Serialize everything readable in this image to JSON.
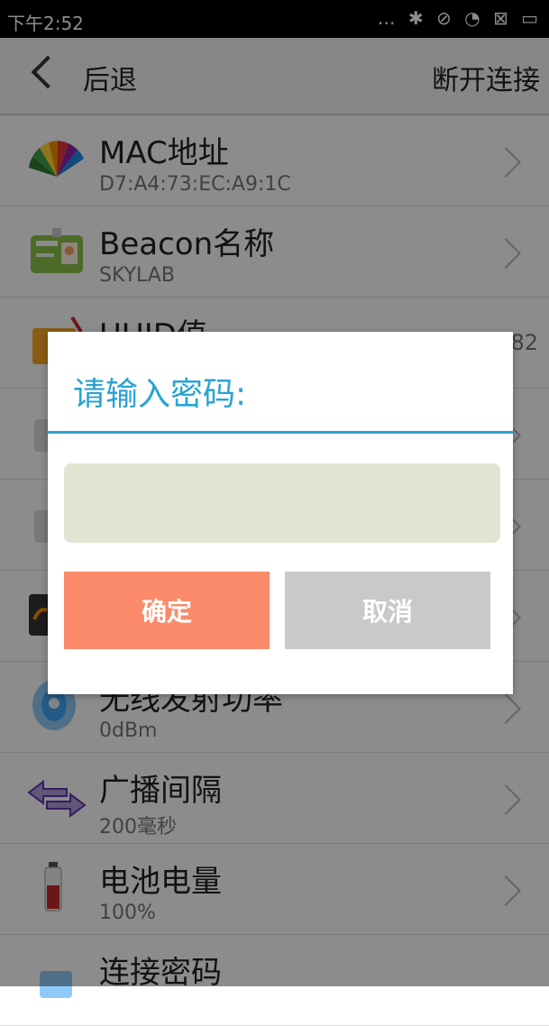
{
  "statusbar": {
    "time": "下午2:52",
    "icons": "… ✱ ⊘ ◔ ⊠ ▭"
  },
  "topbar": {
    "back_label": "后退",
    "right_label": "断开连接"
  },
  "list": [
    {
      "title": "MAC地址",
      "subtitle": "D7:A4:73:EC:A9:1C",
      "icon": "color-fan-icon"
    },
    {
      "title": "Beacon名称",
      "subtitle": "SKYLAB",
      "icon": "id-card-icon"
    },
    {
      "title": "UUID值",
      "subtitle": "",
      "trailing": "82",
      "icon": "notebook-icon"
    },
    {
      "title": "",
      "subtitle": "",
      "icon": "item-icon"
    },
    {
      "title": "",
      "subtitle": "",
      "icon": "item-icon"
    },
    {
      "title": "",
      "subtitle": "",
      "icon": "dark-item-icon"
    },
    {
      "title": "无线发射功率",
      "subtitle": "0dBm",
      "icon": "signal-icon"
    },
    {
      "title": "广播间隔",
      "subtitle": "200毫秒",
      "icon": "arrows-icon"
    },
    {
      "title": "电池电量",
      "subtitle": "100%",
      "icon": "battery-icon"
    },
    {
      "title": "连接密码",
      "subtitle": "",
      "icon": "lock-icon"
    }
  ],
  "dialog": {
    "title": "请输入密码:",
    "password_value": "",
    "ok_label": "确定",
    "cancel_label": "取消"
  },
  "colors": {
    "accent": "#29a3d4",
    "ok_button": "#fb8b6a",
    "cancel_button": "#c9c9c9",
    "input_bg": "#e2e4d3"
  }
}
